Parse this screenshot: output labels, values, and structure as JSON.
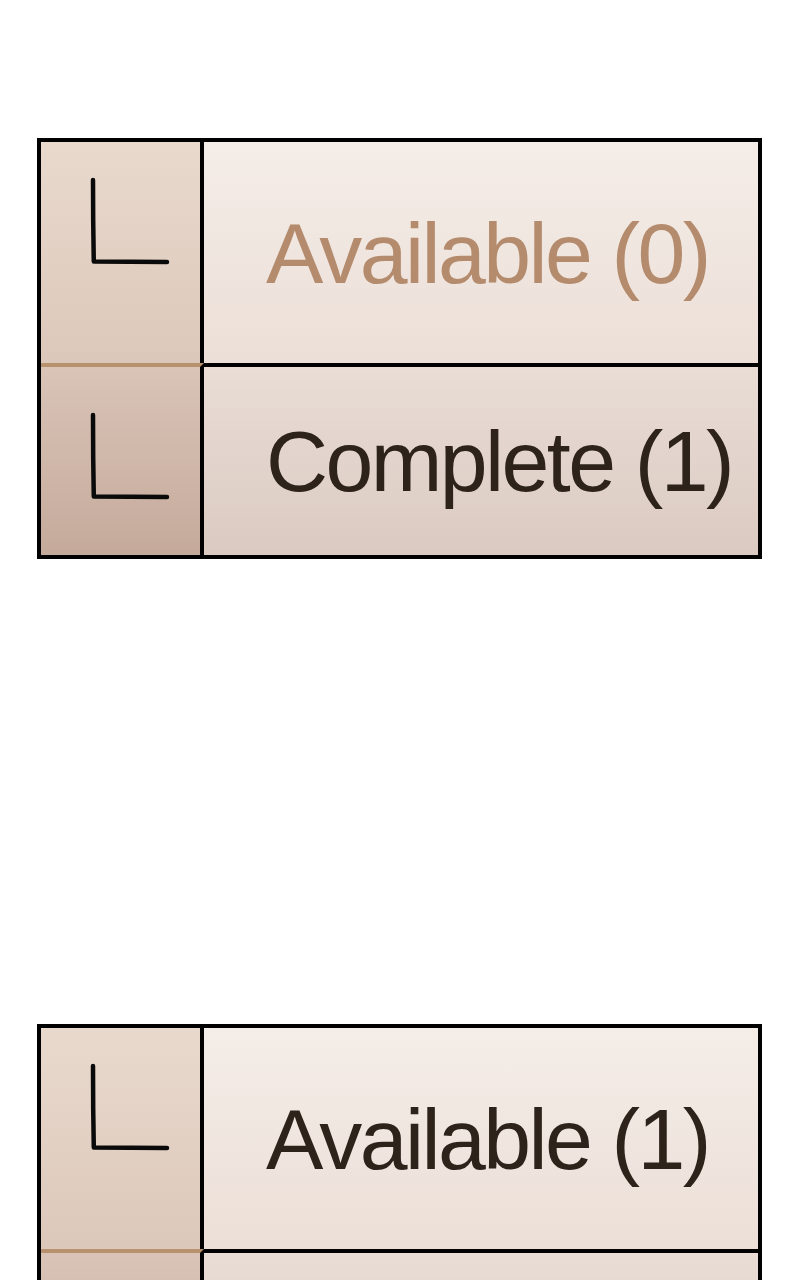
{
  "panels": [
    {
      "rows": [
        {
          "kind": "option",
          "label": "Available (0)",
          "disabled": true
        },
        {
          "kind": "option",
          "label": "Complete (1)",
          "disabled": false
        }
      ]
    },
    {
      "rows": [
        {
          "kind": "option",
          "label": "Available (1)",
          "disabled": false
        },
        {
          "kind": "partial"
        }
      ]
    }
  ]
}
